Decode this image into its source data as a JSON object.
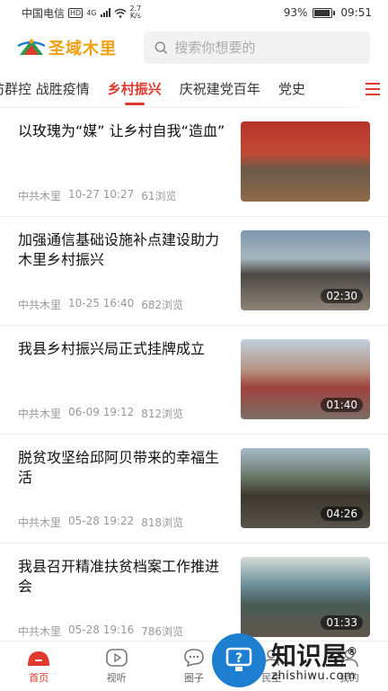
{
  "status": {
    "carrier": "中国电信",
    "hd": "HD",
    "network": "4G",
    "speed_value": "2.7",
    "speed_unit": "K/s",
    "battery": "93%",
    "battery_level": 0.93,
    "time": "09:51"
  },
  "header": {
    "logo_text": "圣域木里",
    "search_placeholder": "搜索你想要的"
  },
  "tabs": [
    {
      "label": "防群控 战胜疫情",
      "active": false
    },
    {
      "label": "乡村振兴",
      "active": true
    },
    {
      "label": "庆祝建党百年",
      "active": false
    },
    {
      "label": "党史",
      "active": false
    }
  ],
  "feed": [
    {
      "title": "以玫瑰为“媒” 让乡村自我“造血”",
      "source": "中共木里",
      "time": "10-27 10:27",
      "views": "61浏览",
      "duration": ""
    },
    {
      "title": "加强通信基础设施补点建设助力木里乡村振兴",
      "source": "中共木里",
      "time": "10-25 16:40",
      "views": "682浏览",
      "duration": "02:30"
    },
    {
      "title": "我县乡村振兴局正式挂牌成立",
      "source": "中共木里",
      "time": "06-09 19:12",
      "views": "812浏览",
      "duration": "01:40"
    },
    {
      "title": "脱贫攻坚给邱阿贝带来的幸福生活",
      "source": "中共木里",
      "time": "05-28 19:22",
      "views": "818浏览",
      "duration": "04:26"
    },
    {
      "title": "我县召开精准扶贫档案工作推进会",
      "source": "中共木里",
      "time": "05-28 19:16",
      "views": "786浏览",
      "duration": "01:33"
    }
  ],
  "bottom_nav": [
    {
      "label": "首页",
      "icon": "home-icon",
      "active": true
    },
    {
      "label": "视听",
      "icon": "play-icon",
      "active": false
    },
    {
      "label": "圈子",
      "icon": "chat-icon",
      "active": false
    },
    {
      "label": "民生",
      "icon": "people-icon",
      "active": false
    },
    {
      "label": "我的",
      "icon": "user-icon",
      "active": false
    }
  ],
  "watermark": {
    "title": "知识屋",
    "registered": "®",
    "url": "zhishiwu.com"
  },
  "colors": {
    "accent": "#e03a2e",
    "logo": "#f0a010"
  }
}
